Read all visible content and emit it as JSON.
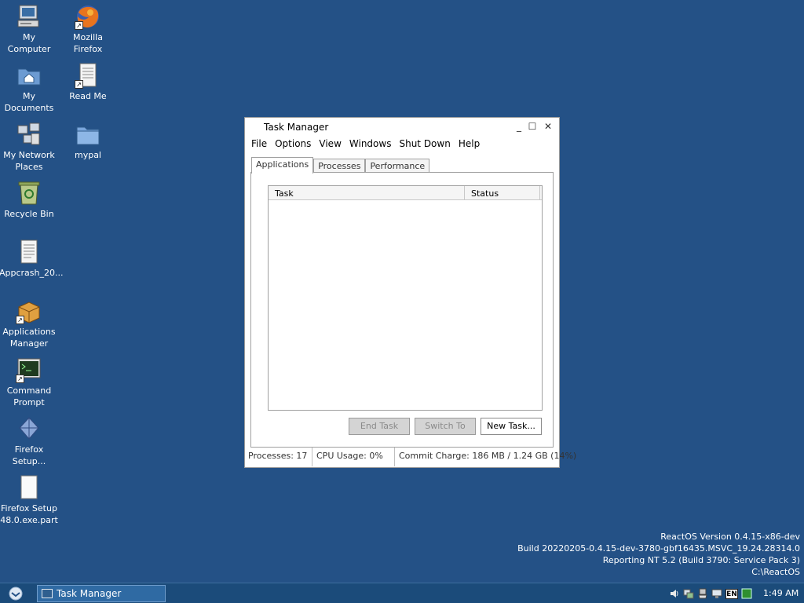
{
  "desktop": {
    "icons": [
      {
        "label": "My\nComputer"
      },
      {
        "label": "Mozilla\nFirefox"
      },
      {
        "label": "My\nDocuments"
      },
      {
        "label": "Read Me"
      },
      {
        "label": "My Network\nPlaces"
      },
      {
        "label": "mypal"
      },
      {
        "label": "Recycle Bin"
      },
      {
        "label": "Appcrash_20..."
      },
      {
        "label": "Applications\nManager"
      },
      {
        "label": "Command\nPrompt"
      },
      {
        "label": "Firefox\nSetup..."
      },
      {
        "label": "Firefox Setup\n48.0.exe.part"
      }
    ]
  },
  "window": {
    "title": "Task Manager",
    "controls": {
      "minimize": "_",
      "maximize": "☐",
      "close": "✕"
    },
    "menu": [
      "File",
      "Options",
      "View",
      "Windows",
      "Shut Down",
      "Help"
    ],
    "tabs": [
      "Applications",
      "Processes",
      "Performance"
    ],
    "list": {
      "columns": [
        "Task",
        "Status"
      ]
    },
    "buttons": {
      "end_task": "End Task",
      "switch_to": "Switch To",
      "new_task": "New Task..."
    },
    "status": {
      "processes": "Processes: 17",
      "cpu": "CPU Usage:  0%",
      "commit": "Commit Charge: 186 MB / 1.24 GB (14%)"
    }
  },
  "version": {
    "line1": "ReactOS Version 0.4.15-x86-dev",
    "line2": "Build 20220205-0.4.15-dev-3780-gbf16435.MSVC_19.24.28314.0",
    "line3": "Reporting NT 5.2 (Build 3790: Service Pack 3)",
    "line4": "C:\\ReactOS"
  },
  "taskbar": {
    "task_label": "Task Manager",
    "language": "EN",
    "clock": "1:49 AM"
  },
  "colors": {
    "desktop": "#245186",
    "taskbar": "#1b4b7a",
    "task_button": "#2f6aa3"
  }
}
